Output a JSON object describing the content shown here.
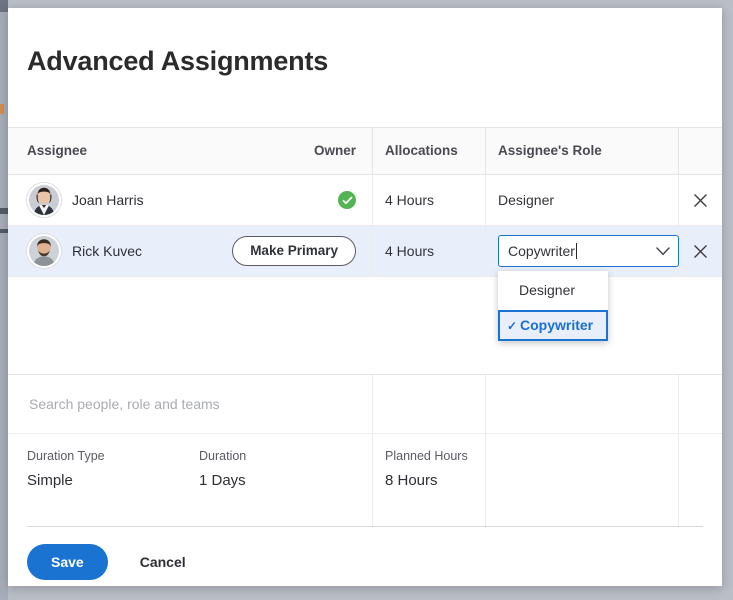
{
  "dialog": {
    "title": "Advanced Assignments"
  },
  "table": {
    "headers": {
      "assignee": "Assignee",
      "owner": "Owner",
      "allocations": "Allocations",
      "role": "Assignee's Role"
    },
    "rows": [
      {
        "name": "Joan Harris",
        "owner_state": "primary-check-icon",
        "allocations": "4 Hours",
        "role": "Designer",
        "remove_icon": "close-icon"
      },
      {
        "name": "Rick Kuvec",
        "owner_action_label": "Make Primary",
        "allocations": "4 Hours",
        "role": "Copywriter",
        "remove_icon": "close-icon"
      }
    ]
  },
  "role_dropdown": {
    "input_value": "Copywriter",
    "chevron_icon": "chevron-down-icon",
    "check_glyph": "✓",
    "options": [
      {
        "label": "Designer",
        "selected": false
      },
      {
        "label": "Copywriter",
        "selected": true
      }
    ]
  },
  "search": {
    "placeholder": "Search people, role and teams",
    "value": ""
  },
  "details": {
    "duration_type_label": "Duration Type",
    "duration_type_value": "Simple",
    "duration_label": "Duration",
    "duration_value": "1 Days",
    "planned_hours_label": "Planned Hours",
    "planned_hours_value": "8 Hours"
  },
  "footer": {
    "save_label": "Save",
    "cancel_label": "Cancel"
  },
  "colors": {
    "accent_blue": "#1a73d1",
    "owner_green": "#52b552",
    "selected_row": "#e8effb",
    "page_background": "#b9bec7"
  }
}
